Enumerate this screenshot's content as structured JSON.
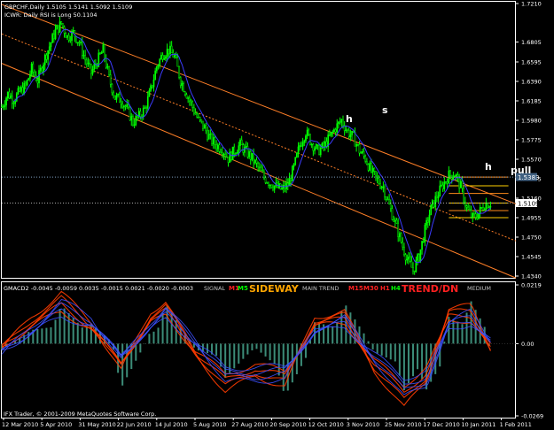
{
  "colors": {
    "background": "#000000",
    "frame": "#ffffff",
    "candle_up": "#00ff00",
    "candle_down": "#00ff00",
    "channel": "#ff7f27",
    "ma_line": "#3c3cff",
    "macd_red": "#ff3c00",
    "macd_blue": "#3c50ff",
    "macd_hist": "#3c8c78",
    "annotation": "#ffffff",
    "price_tag": "#ffffff"
  },
  "main_panel": {
    "title": "GBPCHF,Daily  1.5105 1.5141 1.5092 1.5109",
    "subtitle": "ICWR: Daily RSI is Long 50.1104",
    "current_price": "1.5109",
    "level_price": "1.5383",
    "annotations": [
      "h",
      "s",
      "h",
      "pull"
    ]
  },
  "macd_panel": {
    "title": "GMACD2 -0.0045 -0.0059 0.0035 -0.0015 0.0021 -0.0020 -0.0003",
    "signal_label": "SIGNAL",
    "signal_m1": "M1",
    "signal_m5": "M5",
    "sideway_label": "SIDEWAY",
    "main_trend_label": "MAIN TREND",
    "m15": "M15",
    "m30": "M30",
    "h1": "H1",
    "h4": "H4",
    "trend_label": "TREND/DN",
    "medium_label": "MEDIUM",
    "footer": "IFX Trader, © 2001-2009 MetaQuotes Software Corp."
  },
  "chart_data": [
    {
      "type": "candlestick",
      "title": "GBPCHF,Daily  1.5105 1.5141 1.5092 1.5109",
      "ylim": [
        1.434,
        1.721
      ],
      "yticks": [
        "1.7210",
        "1.6805",
        "1.6595",
        "1.6390",
        "1.6185",
        "1.5980",
        "1.5775",
        "1.5570",
        "1.5365",
        "1.5160",
        "1.4955",
        "1.4750",
        "1.4545",
        "1.4340"
      ],
      "x_tick_labels": [
        "12 Mar 2010",
        "5 Apr 2010",
        "31 May 2010",
        "22 Jun 2010",
        "14 Jul 2010",
        "5 Aug 2010",
        "27 Aug 2010",
        "20 Sep 2010",
        "12 Oct 2010",
        "3 Nov 2010",
        "25 Nov 2010",
        "17 Dec 2010",
        "10 Jan 2011",
        "1 Feb 2011"
      ],
      "close_path": [
        [
          0,
          1.612
        ],
        [
          4,
          1.626
        ],
        [
          8,
          1.62
        ],
        [
          12,
          1.628
        ],
        [
          16,
          1.634
        ],
        [
          20,
          1.652
        ],
        [
          24,
          1.64
        ],
        [
          28,
          1.66
        ],
        [
          32,
          1.676
        ],
        [
          36,
          1.692
        ],
        [
          40,
          1.7
        ],
        [
          44,
          1.686
        ],
        [
          48,
          1.69
        ],
        [
          52,
          1.68
        ],
        [
          56,
          1.662
        ],
        [
          60,
          1.648
        ],
        [
          64,
          1.66
        ],
        [
          68,
          1.672
        ],
        [
          72,
          1.642
        ],
        [
          76,
          1.622
        ],
        [
          80,
          1.62
        ],
        [
          84,
          1.61
        ],
        [
          88,
          1.596
        ],
        [
          92,
          1.602
        ],
        [
          96,
          1.61
        ],
        [
          100,
          1.63
        ],
        [
          104,
          1.655
        ],
        [
          108,
          1.668
        ],
        [
          112,
          1.672
        ],
        [
          116,
          1.665
        ],
        [
          120,
          1.64
        ],
        [
          124,
          1.626
        ],
        [
          128,
          1.612
        ],
        [
          132,
          1.598
        ],
        [
          136,
          1.59
        ],
        [
          140,
          1.578
        ],
        [
          144,
          1.572
        ],
        [
          148,
          1.568
        ],
        [
          152,
          1.558
        ],
        [
          156,
          1.566
        ],
        [
          160,
          1.572
        ],
        [
          164,
          1.565
        ],
        [
          168,
          1.558
        ],
        [
          172,
          1.548
        ],
        [
          176,
          1.538
        ],
        [
          180,
          1.532
        ],
        [
          184,
          1.528
        ],
        [
          188,
          1.525
        ],
        [
          192,
          1.53
        ],
        [
          196,
          1.548
        ],
        [
          200,
          1.572
        ],
        [
          204,
          1.586
        ],
        [
          208,
          1.574
        ],
        [
          212,
          1.566
        ],
        [
          216,
          1.57
        ],
        [
          220,
          1.58
        ],
        [
          224,
          1.59
        ],
        [
          228,
          1.598
        ],
        [
          232,
          1.586
        ],
        [
          236,
          1.58
        ],
        [
          240,
          1.566
        ],
        [
          244,
          1.558
        ],
        [
          248,
          1.544
        ],
        [
          252,
          1.535
        ],
        [
          256,
          1.528
        ],
        [
          260,
          1.508
        ],
        [
          264,
          1.49
        ],
        [
          268,
          1.47
        ],
        [
          272,
          1.452
        ],
        [
          276,
          1.44
        ],
        [
          280,
          1.455
        ],
        [
          284,
          1.482
        ],
        [
          288,
          1.505
        ],
        [
          292,
          1.518
        ],
        [
          296,
          1.53
        ],
        [
          300,
          1.54
        ],
        [
          304,
          1.542
        ],
        [
          308,
          1.528
        ],
        [
          312,
          1.505
        ],
        [
          316,
          1.495
        ],
        [
          320,
          1.5
        ],
        [
          324,
          1.51
        ],
        [
          328,
          1.511
        ]
      ],
      "channel_lines": [
        {
          "from": [
            0,
            1.72
          ],
          "to": [
            345,
            1.51
          ]
        },
        {
          "from": [
            0,
            1.658
          ],
          "to": [
            345,
            1.432
          ]
        },
        {
          "from": [
            0,
            1.689
          ],
          "to": [
            345,
            1.471
          ],
          "dashed": true
        }
      ],
      "fib_levels": [
        1.5383,
        1.529,
        1.521,
        1.5109,
        1.503,
        1.4955
      ],
      "series": [
        {
          "name": "",
          "values": []
        }
      ]
    },
    {
      "type": "line",
      "title": "GMACD2 -0.0045 -0.0059 0.0035 -0.0015 0.0021 -0.0020 -0.0003",
      "ylim": [
        -0.0269,
        0.0219
      ],
      "yticks": [
        "0.0219",
        "0.00",
        "-0.0269"
      ],
      "x_tick_labels": [
        "12 Mar 2010",
        "5 Apr 2010",
        "31 May 2010",
        "22 Jun 2010",
        "14 Jul 2010",
        "5 Aug 2010",
        "27 Aug 2010",
        "20 Sep 2010",
        "12 Oct 2010",
        "3 Nov 2010",
        "25 Nov 2010",
        "17 Dec 2010",
        "10 Jan 2011",
        "1 Feb 2011"
      ],
      "series": [
        {
          "name": "",
          "color": "#ff3c00",
          "x": [
            0,
            20,
            40,
            60,
            80,
            100,
            110,
            130,
            150,
            170,
            190,
            210,
            230,
            250,
            270,
            285,
            300,
            315,
            330
          ],
          "values": [
            -0.002,
            0.01,
            0.019,
            0.008,
            -0.01,
            0.012,
            0.016,
            -0.004,
            -0.018,
            -0.012,
            -0.016,
            0.01,
            0.012,
            -0.01,
            -0.024,
            -0.014,
            0.013,
            0.014,
            -0.004
          ]
        },
        {
          "name": "",
          "color": "#3c50ff",
          "x": [
            0,
            20,
            40,
            60,
            80,
            100,
            110,
            130,
            150,
            170,
            190,
            210,
            230,
            250,
            270,
            285,
            300,
            315,
            330
          ],
          "values": [
            -0.004,
            0.006,
            0.016,
            0.01,
            -0.006,
            0.008,
            0.014,
            0.001,
            -0.014,
            -0.014,
            -0.013,
            0.006,
            0.01,
            -0.006,
            -0.02,
            -0.016,
            0.008,
            0.012,
            0.0
          ]
        }
      ]
    }
  ]
}
